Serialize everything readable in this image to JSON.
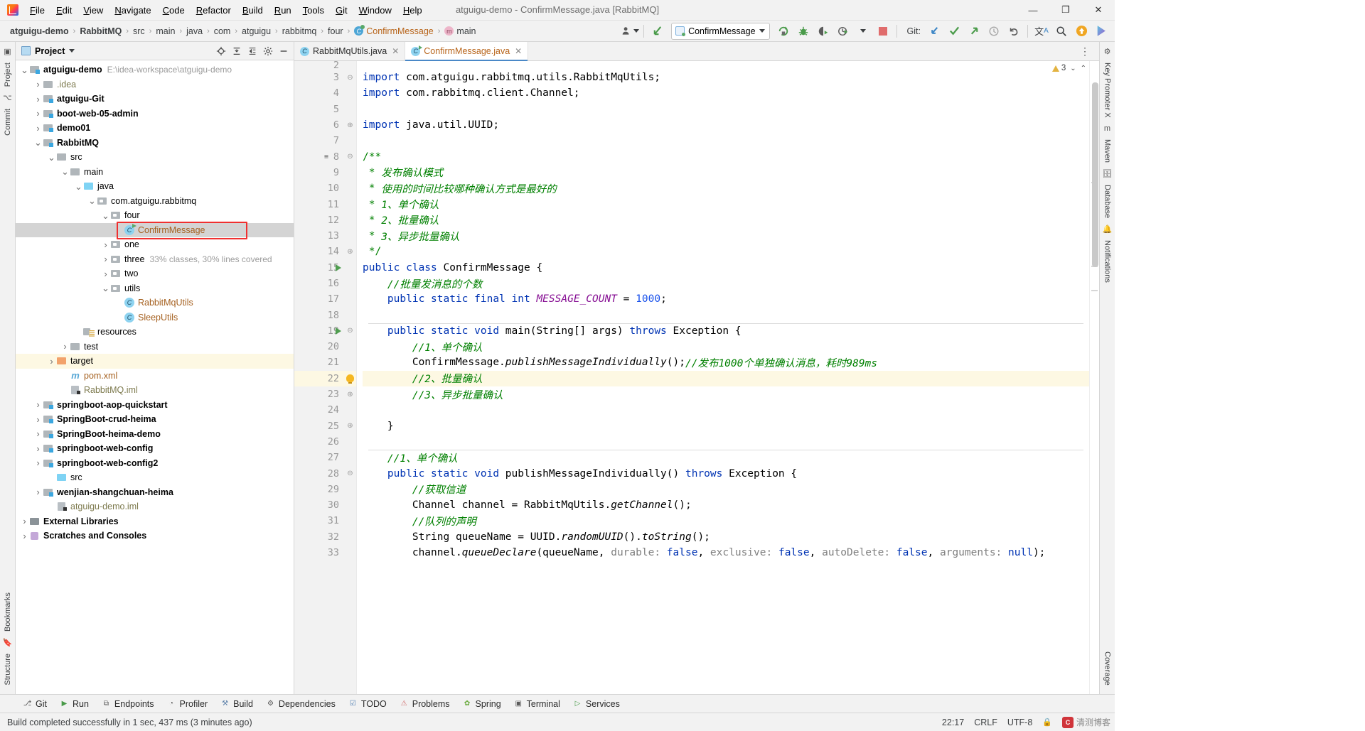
{
  "window": {
    "title": "atguigu-demo - ConfirmMessage.java [RabbitMQ]",
    "minimize": "—",
    "maximize": "❐",
    "close": "✕"
  },
  "menu": [
    "File",
    "Edit",
    "View",
    "Navigate",
    "Code",
    "Refactor",
    "Build",
    "Run",
    "Tools",
    "Git",
    "Window",
    "Help"
  ],
  "breadcrumb": [
    {
      "label": "atguigu-demo",
      "bold": true
    },
    {
      "label": "RabbitMQ",
      "bold": true
    },
    {
      "label": "src",
      "bold": false
    },
    {
      "label": "main",
      "bold": false
    },
    {
      "label": "java",
      "bold": false
    },
    {
      "label": "com",
      "bold": false
    },
    {
      "label": "atguigu",
      "bold": false
    },
    {
      "label": "rabbitmq",
      "bold": false
    },
    {
      "label": "four",
      "bold": false
    },
    {
      "label": "ConfirmMessage",
      "bold": false,
      "icon": "class-icon",
      "color": "orange"
    },
    {
      "label": "main",
      "bold": false,
      "icon": "method-icon"
    }
  ],
  "toolbar": {
    "run_config": "ConfirmMessage",
    "git_label": "Git:",
    "icons": [
      "avatar-icon",
      "search-everywhere-icon",
      "run-icon",
      "debug-icon",
      "run-coverage-icon",
      "profiler-icon",
      "stop-icon",
      "update-project-icon",
      "commit-icon",
      "push-icon",
      "history-icon",
      "rollback-icon",
      "translate-icon",
      "search-icon",
      "update-badge-icon",
      "ide-icon"
    ]
  },
  "left_strip": [
    "Project",
    "Commit"
  ],
  "left_strip_bottom": [
    "Bookmarks",
    "Structure"
  ],
  "right_strip": [
    "Key Promoter X",
    "Maven",
    "Database",
    "Notifications"
  ],
  "right_strip_bottom": [
    "Coverage"
  ],
  "project_panel": {
    "title": "Project",
    "actions": [
      "locate-icon",
      "collapse-all-icon",
      "expand-icon",
      "settings-icon",
      "hide-icon"
    ],
    "tree": [
      {
        "depth": 0,
        "arrow": "v",
        "icon": "module",
        "label": "atguigu-demo",
        "bold": true,
        "sub": "E:\\idea-workspace\\atguigu-demo"
      },
      {
        "depth": 1,
        "arrow": ">",
        "icon": "folder",
        "label": ".idea",
        "color": "olive"
      },
      {
        "depth": 1,
        "arrow": ">",
        "icon": "module",
        "label": "atguigu-Git",
        "bold": true
      },
      {
        "depth": 1,
        "arrow": ">",
        "icon": "module",
        "label": "boot-web-05-admin",
        "bold": true
      },
      {
        "depth": 1,
        "arrow": ">",
        "icon": "module",
        "label": "demo01",
        "bold": true
      },
      {
        "depth": 1,
        "arrow": "v",
        "icon": "module",
        "label": "RabbitMQ",
        "bold": true
      },
      {
        "depth": 2,
        "arrow": "v",
        "icon": "folder",
        "label": "src"
      },
      {
        "depth": 3,
        "arrow": "v",
        "icon": "folder",
        "label": "main"
      },
      {
        "depth": 4,
        "arrow": "v",
        "icon": "folder-blue",
        "label": "java"
      },
      {
        "depth": 5,
        "arrow": "v",
        "icon": "package",
        "label": "com.atguigu.rabbitmq"
      },
      {
        "depth": 6,
        "arrow": "v",
        "icon": "package",
        "label": "four"
      },
      {
        "depth": 7,
        "arrow": "",
        "icon": "class-run",
        "label": "ConfirmMessage",
        "color": "orange",
        "selected": true,
        "highlighted_box": true
      },
      {
        "depth": 6,
        "arrow": ">",
        "icon": "package",
        "label": "one"
      },
      {
        "depth": 6,
        "arrow": ">",
        "icon": "package",
        "label": "three",
        "sub": "33% classes, 30% lines covered"
      },
      {
        "depth": 6,
        "arrow": ">",
        "icon": "package",
        "label": "two"
      },
      {
        "depth": 6,
        "arrow": "v",
        "icon": "package",
        "label": "utils"
      },
      {
        "depth": 7,
        "arrow": "",
        "icon": "class",
        "label": "RabbitMqUtils",
        "color": "orange"
      },
      {
        "depth": 7,
        "arrow": "",
        "icon": "class",
        "label": "SleepUtils",
        "color": "orange"
      },
      {
        "depth": 4,
        "arrow": "",
        "icon": "resources",
        "label": "resources"
      },
      {
        "depth": 3,
        "arrow": ">",
        "icon": "folder",
        "label": "test"
      },
      {
        "depth": 2,
        "arrow": ">",
        "icon": "folder-orange",
        "label": "target",
        "rowHighlight": true
      },
      {
        "depth": 3,
        "arrow": "",
        "icon": "xml",
        "label": "pom.xml",
        "color": "orange"
      },
      {
        "depth": 3,
        "arrow": "",
        "icon": "iml",
        "label": "RabbitMQ.iml",
        "color": "olive"
      },
      {
        "depth": 1,
        "arrow": ">",
        "icon": "module",
        "label": "springboot-aop-quickstart",
        "bold": true
      },
      {
        "depth": 1,
        "arrow": ">",
        "icon": "module",
        "label": "SpringBoot-crud-heima",
        "bold": true
      },
      {
        "depth": 1,
        "arrow": ">",
        "icon": "module",
        "label": "SpringBoot-heima-demo",
        "bold": true
      },
      {
        "depth": 1,
        "arrow": ">",
        "icon": "module",
        "label": "springboot-web-config",
        "bold": true
      },
      {
        "depth": 1,
        "arrow": ">",
        "icon": "module",
        "label": "springboot-web-config2",
        "bold": true
      },
      {
        "depth": 2,
        "arrow": "",
        "icon": "folder-blue",
        "label": "src"
      },
      {
        "depth": 1,
        "arrow": ">",
        "icon": "module",
        "label": "wenjian-shangchuan-heima",
        "bold": true
      },
      {
        "depth": 2,
        "arrow": "",
        "icon": "iml",
        "label": "atguigu-demo.iml",
        "color": "olive"
      },
      {
        "depth": 0,
        "arrow": ">",
        "icon": "lib",
        "label": "External Libraries",
        "bold": true
      },
      {
        "depth": 0,
        "arrow": ">",
        "icon": "scratch",
        "label": "Scratches and Consoles",
        "bold": true
      }
    ]
  },
  "editor": {
    "tabs": [
      {
        "label": "RabbitMqUtils.java",
        "active": false
      },
      {
        "label": "ConfirmMessage.java",
        "active": true
      }
    ],
    "inspections": {
      "count": "3",
      "icon": "warning-triangle"
    },
    "lines": [
      {
        "num": "2",
        "text": "",
        "partial": true
      },
      {
        "num": "3",
        "fold": "minus",
        "tokens": [
          {
            "t": "import ",
            "c": "k"
          },
          {
            "t": "com.atguigu.rabbitmq.utils.RabbitMqUtils;",
            "c": "t"
          }
        ]
      },
      {
        "num": "4",
        "tokens": [
          {
            "t": "import ",
            "c": "k"
          },
          {
            "t": "com.rabbitmq.client.Channel;",
            "c": "t"
          }
        ]
      },
      {
        "num": "5",
        "tokens": []
      },
      {
        "num": "6",
        "fold": "end",
        "tokens": [
          {
            "t": "import ",
            "c": "k"
          },
          {
            "t": "java.util.UUID;",
            "c": "t"
          }
        ]
      },
      {
        "num": "7",
        "tokens": []
      },
      {
        "num": "8",
        "gmark": "doc",
        "fold": "minus",
        "tokens": [
          {
            "t": "/**",
            "c": "s"
          }
        ]
      },
      {
        "num": "9",
        "tokens": [
          {
            "t": " * ",
            "c": "s"
          },
          {
            "t": "发布确认模式",
            "c": "si"
          }
        ]
      },
      {
        "num": "10",
        "tokens": [
          {
            "t": " * ",
            "c": "s"
          },
          {
            "t": "使用的时间比较哪种确认方式是最好的",
            "c": "si"
          }
        ]
      },
      {
        "num": "11",
        "tokens": [
          {
            "t": " * ",
            "c": "s"
          },
          {
            "t": "1、单个确认",
            "c": "si"
          }
        ]
      },
      {
        "num": "12",
        "tokens": [
          {
            "t": " * ",
            "c": "s"
          },
          {
            "t": "2、批量确认",
            "c": "si"
          }
        ]
      },
      {
        "num": "13",
        "tokens": [
          {
            "t": " * ",
            "c": "s"
          },
          {
            "t": "3、异步批量确认",
            "c": "si"
          }
        ]
      },
      {
        "num": "14",
        "fold": "end",
        "tokens": [
          {
            "t": " */",
            "c": "s"
          }
        ]
      },
      {
        "num": "15",
        "run": true,
        "tokens": [
          {
            "t": "public class ",
            "c": "k"
          },
          {
            "t": "ConfirmMessage",
            "c": "cw"
          },
          {
            "t": " {",
            "c": "t"
          }
        ]
      },
      {
        "num": "16",
        "tokens": [
          {
            "t": "    //批量发消息的个数",
            "c": "si"
          }
        ]
      },
      {
        "num": "17",
        "tokens": [
          {
            "t": "    ",
            "c": "t"
          },
          {
            "t": "public static final int ",
            "c": "k"
          },
          {
            "t": "MESSAGE_COUNT",
            "c": "f"
          },
          {
            "t": " = ",
            "c": "t"
          },
          {
            "t": "1000",
            "c": "n"
          },
          {
            "t": ";",
            "c": "t"
          }
        ]
      },
      {
        "num": "18",
        "tokens": []
      },
      {
        "num": "19",
        "run": true,
        "fold": "minus",
        "separator": true,
        "tokens": [
          {
            "t": "    ",
            "c": "t"
          },
          {
            "t": "public static void ",
            "c": "k"
          },
          {
            "t": "main",
            "c": "cw"
          },
          {
            "t": "(String[] args) ",
            "c": "t"
          },
          {
            "t": "throws ",
            "c": "k"
          },
          {
            "t": "Exception {",
            "c": "t"
          }
        ]
      },
      {
        "num": "20",
        "tokens": [
          {
            "t": "        //1、单个确认",
            "c": "si"
          }
        ]
      },
      {
        "num": "21",
        "tokens": [
          {
            "t": "        ConfirmMessage.",
            "c": "t"
          },
          {
            "t": "publishMessageIndividually",
            "c": "m"
          },
          {
            "t": "();",
            "c": "t"
          },
          {
            "t": "//发布1000个单独确认消息，耗时989ms",
            "c": "si"
          }
        ]
      },
      {
        "num": "22",
        "bulb": true,
        "fold": "minus",
        "highlight": true,
        "tokens": [
          {
            "t": "        //2、批量确认",
            "c": "si"
          }
        ]
      },
      {
        "num": "23",
        "fold": "end",
        "tokens": [
          {
            "t": "        //3、异步批量确认",
            "c": "si"
          }
        ]
      },
      {
        "num": "24",
        "tokens": []
      },
      {
        "num": "25",
        "fold": "end",
        "tokens": [
          {
            "t": "    }",
            "c": "t"
          }
        ]
      },
      {
        "num": "26",
        "tokens": []
      },
      {
        "num": "27",
        "separator": true,
        "tokens": [
          {
            "t": "    //1、单个确认",
            "c": "si"
          }
        ]
      },
      {
        "num": "28",
        "fold": "minus",
        "tokens": [
          {
            "t": "    ",
            "c": "t"
          },
          {
            "t": "public static void ",
            "c": "k"
          },
          {
            "t": "publishMessageIndividually",
            "c": "cw"
          },
          {
            "t": "() ",
            "c": "t"
          },
          {
            "t": "throws ",
            "c": "k"
          },
          {
            "t": "Exception {",
            "c": "t"
          }
        ]
      },
      {
        "num": "29",
        "tokens": [
          {
            "t": "        //获取信道",
            "c": "si"
          }
        ]
      },
      {
        "num": "30",
        "tokens": [
          {
            "t": "        Channel channel = RabbitMqUtils.",
            "c": "t"
          },
          {
            "t": "getChannel",
            "c": "m"
          },
          {
            "t": "();",
            "c": "t"
          }
        ]
      },
      {
        "num": "31",
        "tokens": [
          {
            "t": "        //队列的声明",
            "c": "si"
          }
        ]
      },
      {
        "num": "32",
        "tokens": [
          {
            "t": "        String queueName = UUID.",
            "c": "t"
          },
          {
            "t": "randomUUID",
            "c": "m"
          },
          {
            "t": "().",
            "c": "t"
          },
          {
            "t": "toString",
            "c": "m"
          },
          {
            "t": "();",
            "c": "t"
          }
        ]
      },
      {
        "num": "33",
        "tokens": [
          {
            "t": "        channel.",
            "c": "t"
          },
          {
            "t": "queueDeclare",
            "c": "m"
          },
          {
            "t": "(queueName, ",
            "c": "t"
          },
          {
            "t": "durable:",
            "c": "p"
          },
          {
            "t": " ",
            "c": "t"
          },
          {
            "t": "false",
            "c": "k"
          },
          {
            "t": ", ",
            "c": "t"
          },
          {
            "t": "exclusive:",
            "c": "p"
          },
          {
            "t": " ",
            "c": "t"
          },
          {
            "t": "false",
            "c": "k"
          },
          {
            "t": ", ",
            "c": "t"
          },
          {
            "t": "autoDelete:",
            "c": "p"
          },
          {
            "t": " ",
            "c": "t"
          },
          {
            "t": "false",
            "c": "k"
          },
          {
            "t": ", ",
            "c": "t"
          },
          {
            "t": "arguments:",
            "c": "p"
          },
          {
            "t": " ",
            "c": "t"
          },
          {
            "t": "null",
            "c": "k"
          },
          {
            "t": ");",
            "c": "t"
          }
        ]
      }
    ]
  },
  "bottom_toolbar": [
    {
      "label": "Git",
      "icon": "git-icon"
    },
    {
      "label": "Run",
      "icon": "run-icon"
    },
    {
      "label": "Endpoints",
      "icon": "endpoints-icon"
    },
    {
      "label": "Profiler",
      "icon": "profiler-icon"
    },
    {
      "label": "Build",
      "icon": "build-icon"
    },
    {
      "label": "Dependencies",
      "icon": "dependencies-icon"
    },
    {
      "label": "TODO",
      "icon": "todo-icon"
    },
    {
      "label": "Problems",
      "icon": "problems-icon"
    },
    {
      "label": "Spring",
      "icon": "spring-icon"
    },
    {
      "label": "Terminal",
      "icon": "terminal-icon"
    },
    {
      "label": "Services",
      "icon": "services-icon"
    }
  ],
  "statusbar": {
    "message": "Build completed successfully in 1 sec, 437 ms (3 minutes ago)",
    "position": "22:17",
    "line_sep": "CRLF",
    "encoding": "UTF-8",
    "lock": "🔒",
    "watermark": "清测博客"
  }
}
